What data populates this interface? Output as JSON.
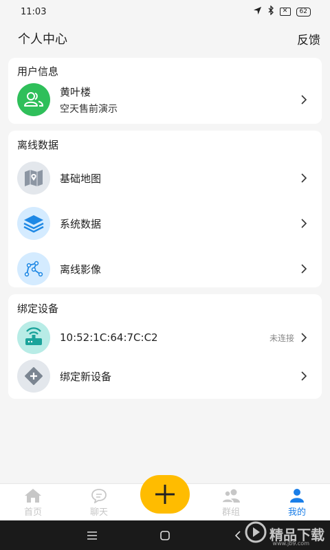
{
  "status_bar": {
    "time": "11:03",
    "battery": "62"
  },
  "header": {
    "title": "个人中心",
    "feedback": "反馈"
  },
  "user_card": {
    "title": "用户信息",
    "name": "黄叶楼",
    "org": "空天售前演示"
  },
  "offline_card": {
    "title": "离线数据",
    "items": [
      {
        "label": "基础地图",
        "icon": "map-icon"
      },
      {
        "label": "系统数据",
        "icon": "layers-icon"
      },
      {
        "label": "离线影像",
        "icon": "polyline-icon"
      }
    ]
  },
  "device_card": {
    "title": "绑定设备",
    "device": {
      "mac": "10:52:1C:64:7C:C2",
      "status": "未连接"
    },
    "bind_new": "绑定新设备"
  },
  "tabbar": {
    "tabs": [
      {
        "label": "首页",
        "icon": "home-icon"
      },
      {
        "label": "聊天",
        "icon": "chat-icon"
      },
      {
        "label": "群组",
        "icon": "group-icon"
      },
      {
        "label": "我的",
        "icon": "profile-icon"
      }
    ],
    "active": "我的"
  },
  "colors": {
    "accent": "#1a7ee8",
    "fab": "#ffbc00",
    "user_avatar": "#2fbf5a",
    "device_avatar": "#b8ece6",
    "inactive_tab": "#c7c7c7"
  },
  "watermark": {
    "text": "精品下载",
    "sub": "www.jb9.com"
  }
}
